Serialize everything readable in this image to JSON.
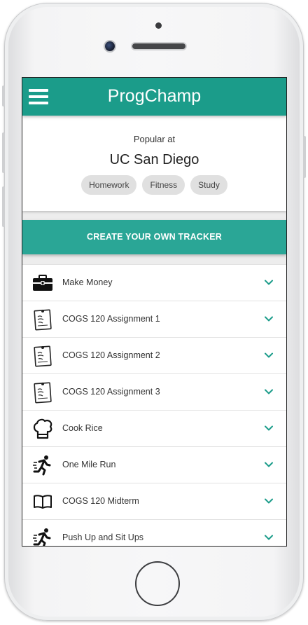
{
  "app": {
    "title": "ProgChamp"
  },
  "popular": {
    "label": "Popular at",
    "school": "UC San Diego",
    "tags": [
      "Homework",
      "Fitness",
      "Study"
    ]
  },
  "create_button": {
    "label": "CREATE YOUR OWN TRACKER"
  },
  "trackers": [
    {
      "label": "Make Money",
      "icon": "briefcase-icon"
    },
    {
      "label": "COGS 120 Assignment 1",
      "icon": "homework-note-icon"
    },
    {
      "label": "COGS 120 Assignment 2",
      "icon": "homework-note-icon"
    },
    {
      "label": "COGS 120 Assignment 3",
      "icon": "homework-note-icon"
    },
    {
      "label": "Cook Rice",
      "icon": "chef-hat-icon"
    },
    {
      "label": "One Mile Run",
      "icon": "runner-icon"
    },
    {
      "label": "COGS 120 Midterm",
      "icon": "open-book-icon"
    },
    {
      "label": "Push Up and Sit Ups",
      "icon": "runner-icon"
    }
  ],
  "colors": {
    "primary": "#1b9c8a",
    "button": "#2aa696",
    "chevron": "#1b9c8a"
  }
}
